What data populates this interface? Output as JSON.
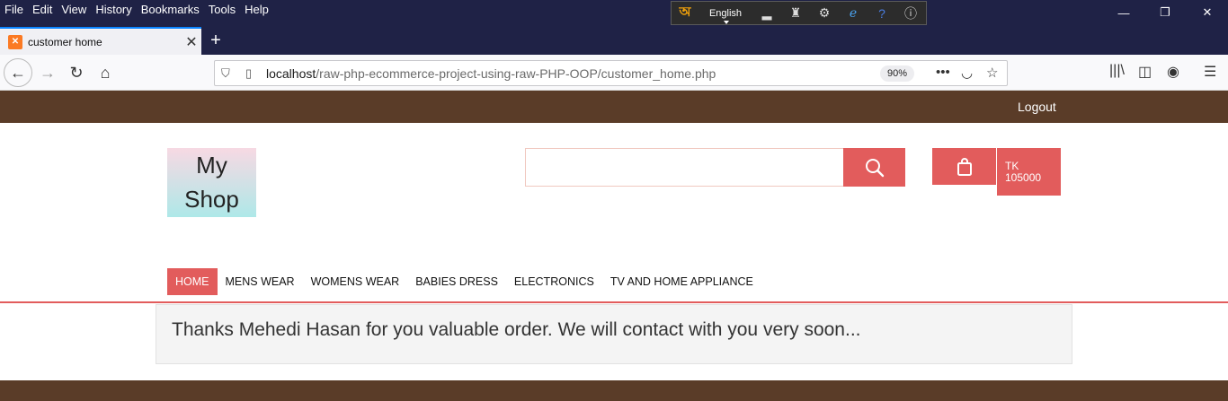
{
  "browser": {
    "menu": [
      "File",
      "Edit",
      "View",
      "History",
      "Bookmarks",
      "Tools",
      "Help"
    ],
    "language": "English",
    "tab_title": "customer home",
    "url_host": "localhost",
    "url_path": "/raw-php-ecommerce-project-using-raw-PHP-OOP/customer_home.php",
    "zoom": "90%"
  },
  "site": {
    "logout_label": "Logout",
    "logo_line1": "My",
    "logo_line2": "Shop",
    "search_value": "",
    "cart_currency": "TK",
    "cart_amount": "105000",
    "nav": [
      "HOME",
      "MENS WEAR",
      "WOMENS WEAR",
      "BABIES DRESS",
      "ELECTRONICS",
      "TV AND HOME APPLIANCE"
    ],
    "active_nav": "HOME",
    "message": "Thanks Mehedi Hasan for you valuable order. We will contact with you very soon..."
  },
  "colors": {
    "accent": "#e25c5c",
    "brown_bar": "#5a3c28",
    "browser_chrome": "#1f2246"
  }
}
